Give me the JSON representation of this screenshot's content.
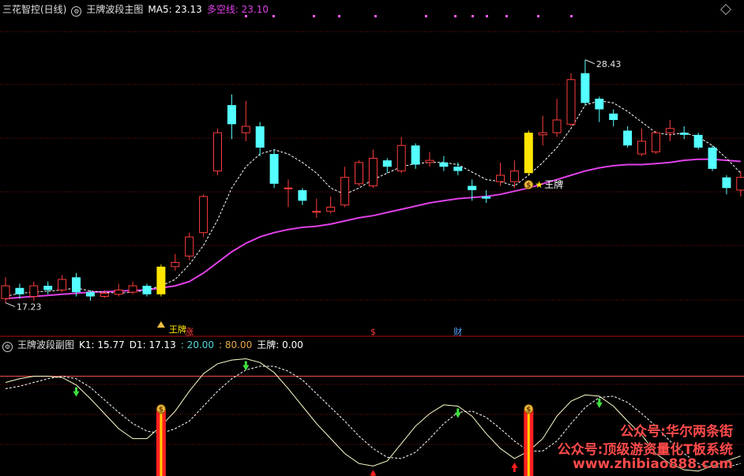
{
  "main_header": {
    "title": "三花智控(日线)",
    "indicator_name": "王牌波段主图",
    "ma5_text": "MA5: 23.13",
    "duokong_text": "多空线: 23.10"
  },
  "sub_header": {
    "indicator_name": "王牌波段副图",
    "k1_text": "K1: 15.77",
    "d1_text": "D1: 17.13",
    "v20_text": ": 20.00",
    "v80_text": ": 80.00",
    "wangpai_text": "王牌: 0.00"
  },
  "watermark": {
    "line1": "公众号:华尔两条街",
    "line2": "公众号:顶级游资量化T板系统",
    "line3": "www.zhibiao888.com"
  },
  "colors": {
    "up": "#ff3c3c",
    "down": "#54ffff",
    "signal": "#ffe600",
    "duokong": "#e040e8",
    "ma5": "#ffffff",
    "grid": "#7a1010",
    "sep": "#b01010"
  },
  "chart_data": [
    {
      "type": "candlestick",
      "title": "王牌波段主图",
      "ylim": [
        15.5,
        30.5
      ],
      "annotations": {
        "high_label": "28.43",
        "low_label": "17.23",
        "signal_label": "王牌",
        "bottom_label": "王牌"
      },
      "markers": [
        {
          "index": 13,
          "text": "涨",
          "color": "#ff3c3c"
        },
        {
          "index": 26,
          "text": "$",
          "color": "#ff3c3c"
        },
        {
          "index": 32,
          "text": "财",
          "color": "#54a0ff"
        }
      ],
      "candles": [
        {
          "o": 17.2,
          "c": 17.8,
          "h": 18.2,
          "l": 17.0
        },
        {
          "o": 17.7,
          "c": 17.4,
          "h": 17.9,
          "l": 17.2
        },
        {
          "o": 17.3,
          "c": 17.8,
          "h": 18.0,
          "l": 17.1
        },
        {
          "o": 17.8,
          "c": 17.6,
          "h": 18.0,
          "l": 17.4
        },
        {
          "o": 17.6,
          "c": 18.1,
          "h": 18.3,
          "l": 17.5
        },
        {
          "o": 18.2,
          "c": 17.5,
          "h": 18.4,
          "l": 17.3
        },
        {
          "o": 17.5,
          "c": 17.3,
          "h": 17.6,
          "l": 17.1
        },
        {
          "o": 17.3,
          "c": 17.45,
          "h": 17.6,
          "l": 17.23
        },
        {
          "o": 17.4,
          "c": 17.6,
          "h": 17.9,
          "l": 17.3
        },
        {
          "o": 17.5,
          "c": 17.8,
          "h": 18.0,
          "l": 17.4
        },
        {
          "o": 17.8,
          "c": 17.4,
          "h": 17.9,
          "l": 17.3
        },
        {
          "o": 17.4,
          "c": 18.7,
          "h": 18.8,
          "l": 17.3,
          "signal": true
        },
        {
          "o": 18.7,
          "c": 18.9,
          "h": 19.3,
          "l": 18.5
        },
        {
          "o": 19.2,
          "c": 20.1,
          "h": 20.3,
          "l": 19.0
        },
        {
          "o": 20.3,
          "c": 22.0,
          "h": 22.1,
          "l": 20.1
        },
        {
          "o": 23.2,
          "c": 25.0,
          "h": 25.2,
          "l": 23.0
        },
        {
          "o": 26.3,
          "c": 25.4,
          "h": 26.8,
          "l": 24.7
        },
        {
          "o": 25.0,
          "c": 25.3,
          "h": 26.5,
          "l": 24.6
        },
        {
          "o": 25.3,
          "c": 24.3,
          "h": 25.5,
          "l": 23.9
        },
        {
          "o": 24.0,
          "c": 22.6,
          "h": 24.2,
          "l": 22.4
        },
        {
          "o": 22.4,
          "c": 22.4,
          "h": 22.8,
          "l": 21.5
        },
        {
          "o": 22.3,
          "c": 21.8,
          "h": 22.4,
          "l": 21.6
        },
        {
          "o": 21.3,
          "c": 21.3,
          "h": 21.9,
          "l": 21.0
        },
        {
          "o": 21.3,
          "c": 21.5,
          "h": 22.0,
          "l": 21.2
        },
        {
          "o": 21.6,
          "c": 22.9,
          "h": 23.4,
          "l": 21.5
        },
        {
          "o": 22.6,
          "c": 23.6,
          "h": 23.7,
          "l": 22.5
        },
        {
          "o": 22.5,
          "c": 23.8,
          "h": 24.2,
          "l": 22.4
        },
        {
          "o": 23.7,
          "c": 23.4,
          "h": 23.8,
          "l": 23.1
        },
        {
          "o": 23.2,
          "c": 24.4,
          "h": 24.8,
          "l": 23.1
        },
        {
          "o": 24.4,
          "c": 23.5,
          "h": 24.5,
          "l": 23.3
        },
        {
          "o": 23.6,
          "c": 23.7,
          "h": 24.1,
          "l": 23.4
        },
        {
          "o": 23.6,
          "c": 23.4,
          "h": 23.9,
          "l": 23.2
        },
        {
          "o": 23.4,
          "c": 23.2,
          "h": 23.6,
          "l": 23.0
        },
        {
          "o": 22.5,
          "c": 22.3,
          "h": 22.8,
          "l": 21.8
        },
        {
          "o": 22.0,
          "c": 21.9,
          "h": 22.3,
          "l": 21.7
        },
        {
          "o": 22.7,
          "c": 23.0,
          "h": 23.6,
          "l": 22.5
        },
        {
          "o": 22.7,
          "c": 23.2,
          "h": 23.7,
          "l": 22.4
        },
        {
          "o": 23.1,
          "c": 25.0,
          "h": 25.1,
          "l": 23.0,
          "signal": true
        },
        {
          "o": 24.9,
          "c": 25.0,
          "h": 25.8,
          "l": 24.4
        },
        {
          "o": 25.0,
          "c": 25.6,
          "h": 26.6,
          "l": 24.8
        },
        {
          "o": 25.4,
          "c": 27.5,
          "h": 27.8,
          "l": 25.3
        },
        {
          "o": 27.8,
          "c": 26.4,
          "h": 28.43,
          "l": 26.3
        },
        {
          "o": 26.6,
          "c": 26.1,
          "h": 26.7,
          "l": 25.5
        },
        {
          "o": 25.9,
          "c": 25.6,
          "h": 26.1,
          "l": 25.3
        },
        {
          "o": 25.1,
          "c": 24.4,
          "h": 25.3,
          "l": 24.3
        },
        {
          "o": 24.0,
          "c": 24.6,
          "h": 25.2,
          "l": 23.9
        },
        {
          "o": 24.1,
          "c": 25.0,
          "h": 25.1,
          "l": 24.0
        },
        {
          "o": 25.0,
          "c": 25.2,
          "h": 25.6,
          "l": 24.6
        },
        {
          "o": 25.0,
          "c": 24.9,
          "h": 25.3,
          "l": 24.7
        },
        {
          "o": 24.9,
          "c": 24.3,
          "h": 25.0,
          "l": 24.2
        },
        {
          "o": 24.3,
          "c": 23.3,
          "h": 24.4,
          "l": 23.2
        },
        {
          "o": 22.9,
          "c": 22.4,
          "h": 23.0,
          "l": 22.1
        },
        {
          "o": 22.3,
          "c": 22.9,
          "h": 23.2,
          "l": 22.0
        }
      ],
      "ma5": [
        17.3,
        17.45,
        17.5,
        17.55,
        17.6,
        17.7,
        17.55,
        17.5,
        17.45,
        17.5,
        17.6,
        17.8,
        18.1,
        18.8,
        19.7,
        20.9,
        22.4,
        23.4,
        24.0,
        24.2,
        24.0,
        23.6,
        23.1,
        22.4,
        22.1,
        22.4,
        22.8,
        23.1,
        23.4,
        23.55,
        23.6,
        23.6,
        23.5,
        23.15,
        22.8,
        22.7,
        22.5,
        23.0,
        23.6,
        24.3,
        25.2,
        26.3,
        26.5,
        26.4,
        26.0,
        25.5,
        25.0,
        24.9,
        25.0,
        24.8,
        24.4,
        23.8,
        23.1
      ],
      "duokong": [
        17.2,
        17.25,
        17.3,
        17.35,
        17.4,
        17.45,
        17.5,
        17.52,
        17.55,
        17.58,
        17.6,
        17.7,
        17.8,
        18.0,
        18.4,
        18.9,
        19.4,
        19.8,
        20.1,
        20.3,
        20.45,
        20.55,
        20.6,
        20.7,
        20.85,
        21.0,
        21.1,
        21.25,
        21.4,
        21.55,
        21.7,
        21.8,
        21.9,
        21.95,
        22.0,
        22.1,
        22.25,
        22.4,
        22.6,
        22.8,
        23.0,
        23.2,
        23.35,
        23.45,
        23.5,
        23.5,
        23.55,
        23.6,
        23.7,
        23.75,
        23.75,
        23.7,
        23.65
      ]
    },
    {
      "type": "line",
      "title": "王牌波段副图",
      "ylim": [
        0,
        100
      ],
      "ref_line": 80,
      "series": [
        {
          "name": "K1",
          "values": [
            75,
            78,
            80,
            80,
            79,
            73,
            62,
            50,
            38,
            30,
            30,
            40,
            52,
            68,
            82,
            90,
            93,
            94,
            91,
            83,
            70,
            56,
            42,
            30,
            18,
            10,
            8,
            12,
            26,
            40,
            50,
            57,
            56,
            48,
            34,
            22,
            14,
            20,
            30,
            48,
            60,
            65,
            64,
            56,
            44,
            33,
            18,
            10,
            5,
            4,
            8,
            12,
            16
          ]
        },
        {
          "name": "D1",
          "values": [
            70,
            72,
            75,
            78,
            80,
            78,
            71,
            61,
            51,
            42,
            36,
            34,
            38,
            44,
            56,
            68,
            78,
            85,
            88,
            88,
            84,
            77,
            66,
            55,
            44,
            32,
            22,
            15,
            14,
            19,
            30,
            42,
            51,
            52,
            47,
            38,
            28,
            20,
            20,
            28,
            42,
            55,
            63,
            64,
            59,
            50,
            40,
            28,
            18,
            10,
            7,
            7,
            10
          ]
        }
      ],
      "down_arrows": [
        5,
        17,
        32,
        42
      ],
      "up_arrows": [
        26,
        36
      ],
      "signal_bars": [
        11,
        37
      ]
    }
  ]
}
